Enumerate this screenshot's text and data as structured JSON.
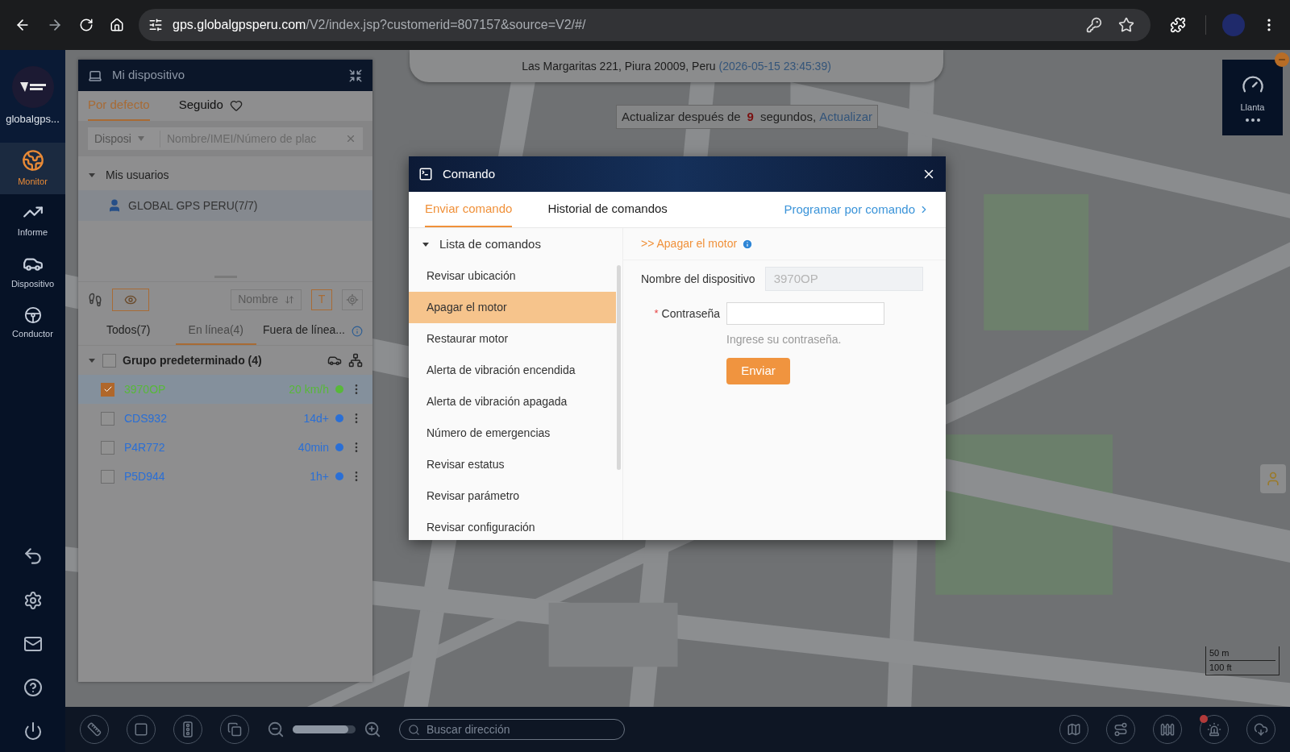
{
  "browser": {
    "host": "gps.globalgpsperu.com",
    "path": "/V2/index.jsp?customerid=807157&source=V2/#/"
  },
  "nav": {
    "brand": "globalgps...",
    "items": [
      {
        "label": "Monitor",
        "selected": true
      },
      {
        "label": "Informe",
        "selected": false
      },
      {
        "label": "Dispositivo",
        "selected": false
      },
      {
        "label": "Conductor",
        "selected": false
      }
    ]
  },
  "address": {
    "text": "Las Margaritas 221, Piura 20009, Peru",
    "time": "(2026-05-15 23:45:39)"
  },
  "refresh": {
    "before": "Actualizar después de",
    "seconds": "9",
    "after": "segundos,",
    "link": "Actualizar"
  },
  "tire_widget": {
    "label": "Llanta"
  },
  "device_panel": {
    "title": "Mi dispositivo",
    "tabs": [
      {
        "label": "Por defecto",
        "selected": true
      },
      {
        "label": "Seguido",
        "selected": false
      }
    ],
    "search": {
      "type": "Disposi",
      "placeholder": "Nombre/IMEI/Número de plac"
    },
    "tree": {
      "label": "Mis usuarios",
      "expanded": true,
      "children": [
        {
          "label": "GLOBAL GPS PERU(7/7)",
          "selected": true
        }
      ]
    },
    "sort": "Nombre",
    "text_toggle": "T",
    "filters": [
      {
        "label": "Todos(7)",
        "selected": false
      },
      {
        "label": "En línea(4)",
        "selected": true
      },
      {
        "label": "Fuera de línea...",
        "selected": false
      }
    ],
    "group": {
      "label": "Grupo predeterminado (4)",
      "expanded": true,
      "checked": false
    },
    "devices": [
      {
        "name": "3970OP",
        "status": "20 km/h",
        "color": "#58b83a",
        "checked": true,
        "selected": true
      },
      {
        "name": "CDS932",
        "status": "14d+",
        "color": "#2a6fd6",
        "checked": false,
        "selected": false
      },
      {
        "name": "P4R772",
        "status": "40min",
        "color": "#2a6fd6",
        "checked": false,
        "selected": false
      },
      {
        "name": "P5D944",
        "status": "1h+",
        "color": "#2a6fd6",
        "checked": false,
        "selected": false
      }
    ]
  },
  "modal": {
    "title": "Comando",
    "tabs": [
      {
        "label": "Enviar comando",
        "selected": true
      },
      {
        "label": "Historial de comandos",
        "selected": false
      }
    ],
    "link": "Programar por comando",
    "list_header": "Lista de comandos",
    "commands": [
      {
        "label": "Revisar ubicación",
        "selected": false
      },
      {
        "label": "Apagar el motor",
        "selected": true
      },
      {
        "label": "Restaurar motor",
        "selected": false
      },
      {
        "label": "Alerta de vibración encendida",
        "selected": false
      },
      {
        "label": "Alerta de vibración apagada",
        "selected": false
      },
      {
        "label": "Número de emergencias",
        "selected": false
      },
      {
        "label": "Revisar estatus",
        "selected": false
      },
      {
        "label": "Revisar parámetro",
        "selected": false
      },
      {
        "label": "Revisar configuración",
        "selected": false
      }
    ],
    "command_title": ">> Apagar el motor",
    "device_label": "Nombre del dispositivo",
    "device_value": "3970OP",
    "password_required": "*",
    "password_label": "Contraseña",
    "password_hint": "Ingrese su contraseña.",
    "submit": "Enviar"
  },
  "toolbar": {
    "search_placeholder": "Buscar dirección",
    "zoom": {
      "level": 0.88
    },
    "alarm_dot": true
  },
  "scale": {
    "metric": "50 m",
    "imperial": "100 ft"
  }
}
